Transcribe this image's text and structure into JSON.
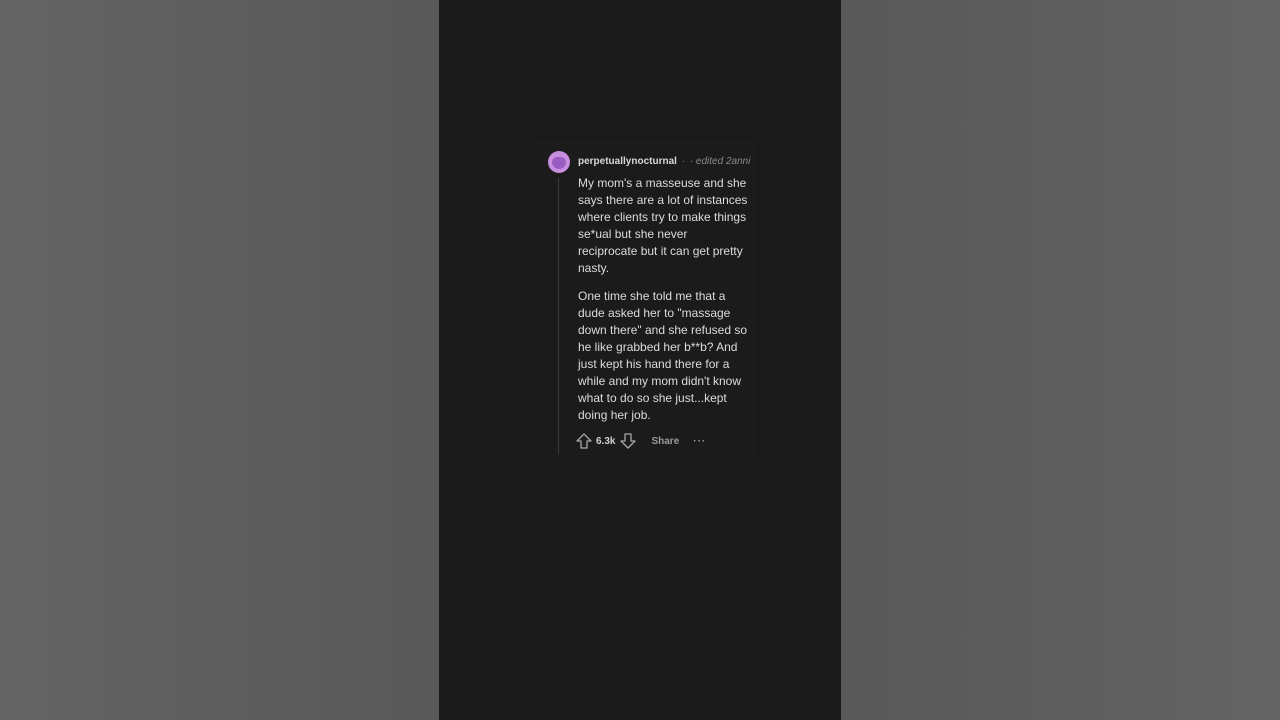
{
  "comment": {
    "username": "perpetuallynocturnal",
    "separator": "·",
    "edited_label": "· edited 2anni",
    "paragraphs": [
      "My mom's a masseuse and she says there are a lot of instances where clients try to make things se*ual but she never reciprocate but it can get pretty nasty.",
      "One time she told me that a dude asked her to \"massage down there\" and she refused so he like grabbed her b**b? And just kept his hand there for a while and my mom didn't know what to do so she just...kept doing her job."
    ],
    "score": "6.3k",
    "share_label": "Share",
    "more_label": "···",
    "icons": {
      "avatar": "snoo-avatar-icon",
      "upvote": "upvote-arrow-icon",
      "downvote": "downvote-arrow-icon",
      "more": "more-options-icon"
    }
  },
  "colors": {
    "avatar": "#c88fe0",
    "frame_background": "#1a1a1a",
    "side_background": "#5b5b5b"
  }
}
